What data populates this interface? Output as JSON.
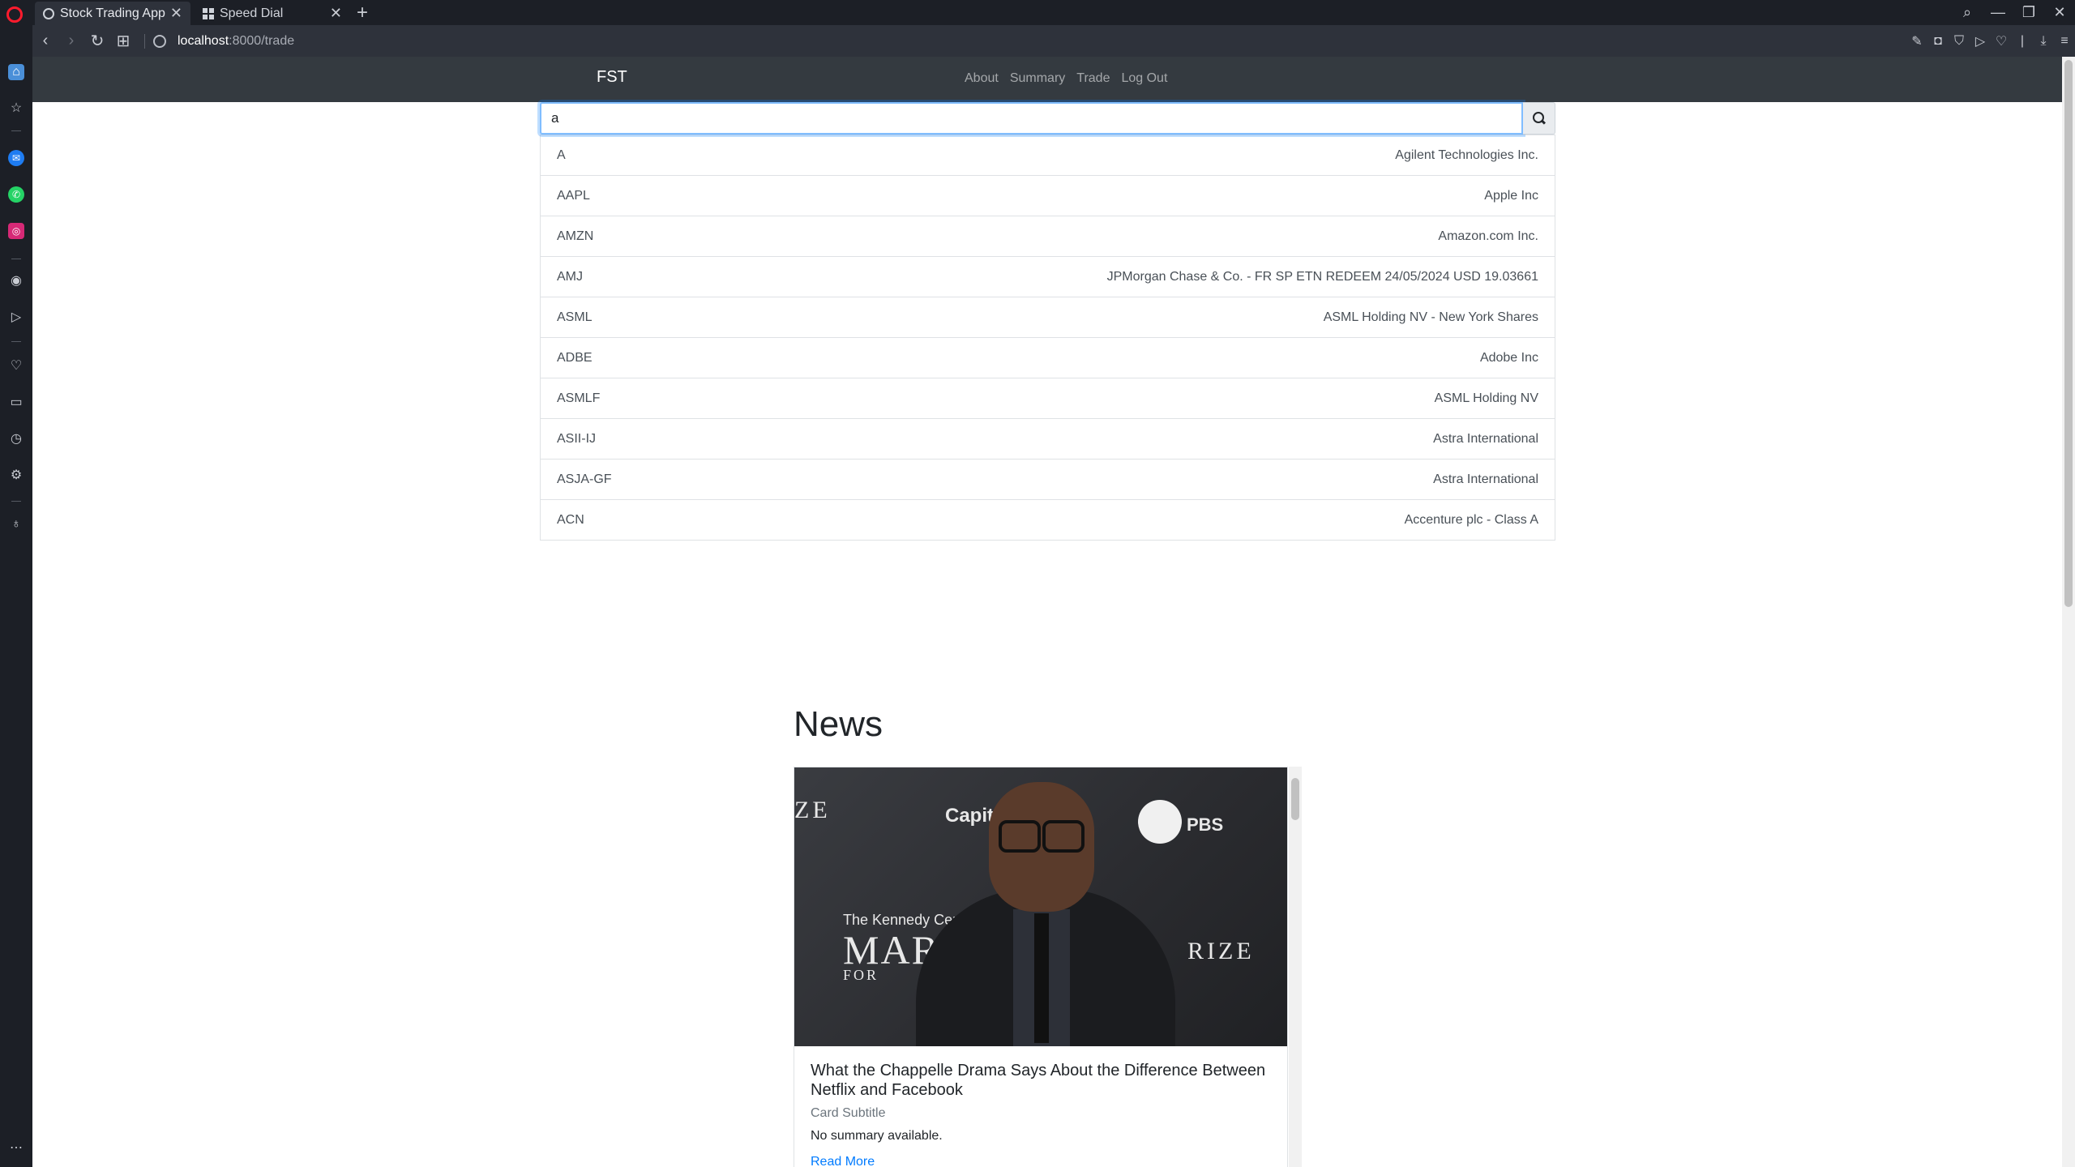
{
  "browser": {
    "tabs": [
      {
        "title": "Stock Trading App",
        "icon": "globe-icon",
        "active": true
      },
      {
        "title": "Speed Dial",
        "icon": "grid-icon",
        "active": false
      }
    ],
    "new_tab_glyph": "+",
    "url_host": "localhost",
    "url_path": ":8000/trade"
  },
  "navbar": {
    "brand": "FST",
    "links": [
      "About",
      "Summary",
      "Trade",
      "Log Out"
    ]
  },
  "search": {
    "value": "a",
    "button_icon": "search-icon",
    "results": [
      {
        "symbol": "A",
        "name": "Agilent Technologies Inc."
      },
      {
        "symbol": "AAPL",
        "name": "Apple Inc"
      },
      {
        "symbol": "AMZN",
        "name": "Amazon.com Inc."
      },
      {
        "symbol": "AMJ",
        "name": "JPMorgan Chase & Co. - FR SP ETN REDEEM 24/05/2024 USD 19.03661"
      },
      {
        "symbol": "ASML",
        "name": "ASML Holding NV - New York Shares"
      },
      {
        "symbol": "ADBE",
        "name": "Adobe Inc"
      },
      {
        "symbol": "ASMLF",
        "name": "ASML Holding NV"
      },
      {
        "symbol": "ASII-IJ",
        "name": "Astra International"
      },
      {
        "symbol": "ASJA-GF",
        "name": "Astra International"
      },
      {
        "symbol": "ACN",
        "name": "Accenture plc - Class A"
      }
    ]
  },
  "news": {
    "heading": "News",
    "card": {
      "image_logos": {
        "left_fragment": "ZE",
        "capital": "Capit",
        "pbs": "PBS",
        "kennedy": "The Kennedy Cent",
        "mark": "MAR",
        "for": "FOR",
        "prize": "RIZE"
      },
      "title": "What the Chappelle Drama Says About the Difference Between Netflix and Facebook",
      "subtitle": "Card Subtitle",
      "text": "No summary available.",
      "link": "Read More"
    }
  }
}
